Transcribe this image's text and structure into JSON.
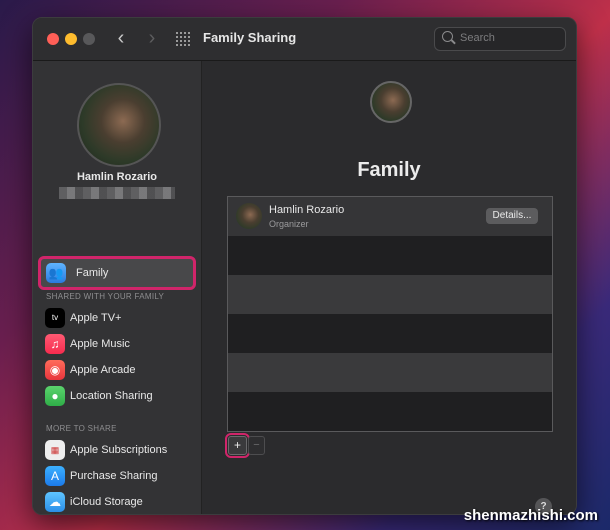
{
  "window": {
    "title": "Family Sharing",
    "search_placeholder": "Search"
  },
  "icons": {
    "back": "‹",
    "forward": "›",
    "plus": "+",
    "minus": "−",
    "help": "?"
  },
  "sidebar": {
    "user_name": "Hamlin Rozario",
    "family_item": {
      "label": "Family",
      "icon": "family-icon"
    },
    "shared_header": "SHARED WITH YOUR FAMILY",
    "shared_items": [
      {
        "label": "Apple TV+",
        "icon": "apple-tv-icon"
      },
      {
        "label": "Apple Music",
        "icon": "apple-music-icon"
      },
      {
        "label": "Apple Arcade",
        "icon": "apple-arcade-icon"
      },
      {
        "label": "Location Sharing",
        "icon": "location-sharing-icon"
      }
    ],
    "more_header": "MORE TO SHARE",
    "more_items": [
      {
        "label": "Apple Subscriptions",
        "icon": "apple-subscriptions-icon"
      },
      {
        "label": "Purchase Sharing",
        "icon": "purchase-sharing-icon"
      },
      {
        "label": "iCloud Storage",
        "icon": "icloud-storage-icon"
      }
    ]
  },
  "main": {
    "title": "Family",
    "members": [
      {
        "name": "Hamlin Rozario",
        "role": "Organizer",
        "details_label": "Details..."
      }
    ]
  },
  "watermark": "shenmazhishi.com",
  "colors": {
    "highlight": "#d0256a",
    "window_bg": "#2b2b2d"
  }
}
